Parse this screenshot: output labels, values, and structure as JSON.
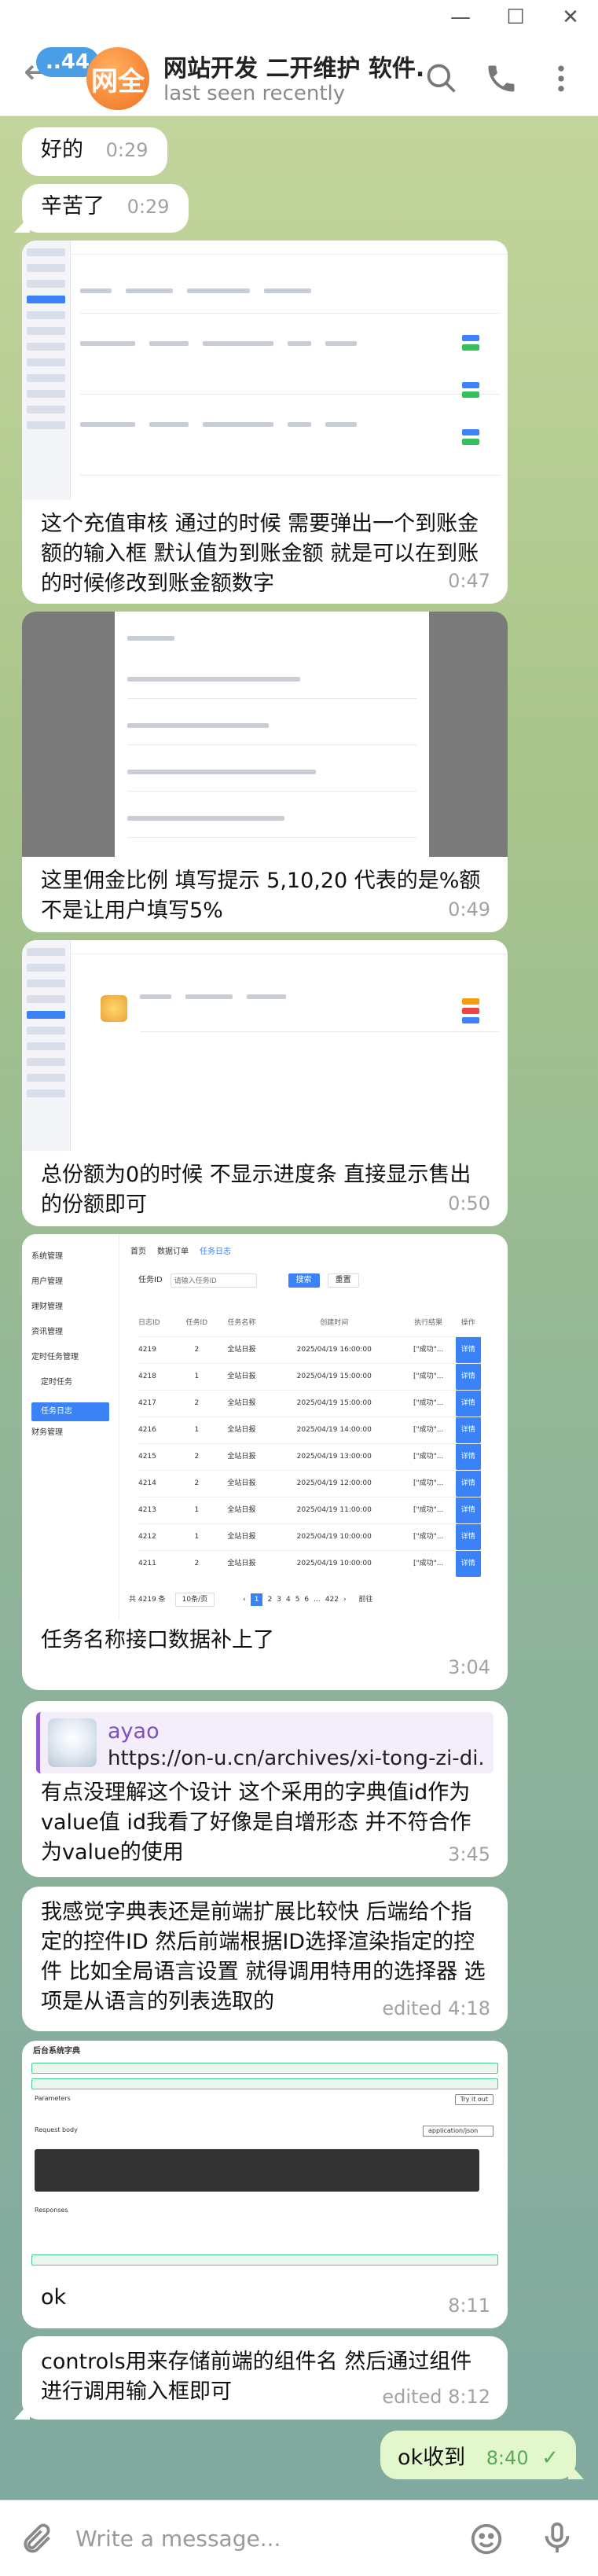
{
  "header": {
    "unread_count": "..44",
    "avatar_text": "网全",
    "title": "网站开发 二开维护 软件...",
    "status": "last seen recently"
  },
  "messages": [
    {
      "text": "好的",
      "time": "0:29"
    },
    {
      "text": "辛苦了",
      "time": "0:29"
    },
    {
      "text": "这个充值审核 通过的时候 需要弹出一个到账金额的输入框 默认值为到账金额 就是可以在到账的时候修改到账金额数字",
      "time": "0:47"
    },
    {
      "text": "这里佣金比例 填写提示 5,10,20 代表的是%额不是让用户填写5%",
      "time": "0:49"
    },
    {
      "text": "总份额为0的时候 不显示进度条 直接显示售出的份额即可",
      "time": "0:50"
    },
    {
      "text": "任务名称接口数据补上了",
      "time": "3:04"
    },
    {
      "link_site": "ayao",
      "link_url": "https://on-u.cn/archives/xi-tong-zi-di...",
      "text": "有点没理解这个设计 这个采用的字典值id作为value值 id我看了好像是自增形态 并不符合作为value的使用",
      "time": "3:45"
    },
    {
      "text": "我感觉字典表还是前端扩展比较快 后端给个指定的控件ID 然后前端根据ID选择渲染指定的控件 比如全局语言设置 就得调用特用的选择器 选项是从语言的列表选取的",
      "time": "edited 4:18"
    },
    {
      "text": "ok",
      "time": "8:11"
    },
    {
      "text": "controls用来存储前端的组件名 然后通过组件进行调用输入框即可",
      "time": "edited 8:12"
    }
  ],
  "outgoing": {
    "text": "ok收到",
    "time": "8:40",
    "check": "✓"
  },
  "screenshot4": {
    "tabs": [
      "首页",
      "数据订单",
      "任务日志"
    ],
    "search_label": "任务ID",
    "search_placeholder": "请输入任务ID",
    "search_button": "搜索",
    "reset_button": "重置",
    "sidebar": [
      "系统管理",
      "用户管理",
      "理财管理",
      "资讯管理",
      "定时任务管理",
      "定时任务",
      "任务日志",
      "财务管理"
    ],
    "columns": [
      "日志ID",
      "任务ID",
      "任务名称",
      "创建时间",
      "执行结果",
      "操作"
    ],
    "rows": [
      [
        "4219",
        "2",
        "全站日报",
        "2025/04/19 16:00:00",
        "[\"成功\"...",
        "详情"
      ],
      [
        "4218",
        "1",
        "全站日报",
        "2025/04/19 15:00:00",
        "[\"成功\"...",
        "详情"
      ],
      [
        "4217",
        "2",
        "全站日报",
        "2025/04/19 15:00:00",
        "[\"成功\"...",
        "详情"
      ],
      [
        "4216",
        "1",
        "全站日报",
        "2025/04/19 14:00:00",
        "[\"成功\"...",
        "详情"
      ],
      [
        "4215",
        "2",
        "全站日报",
        "2025/04/19 13:00:00",
        "[\"成功\"...",
        "详情"
      ],
      [
        "4214",
        "2",
        "全站日报",
        "2025/04/19 12:00:00",
        "[\"成功\"...",
        "详情"
      ],
      [
        "4213",
        "1",
        "全站日报",
        "2025/04/19 11:00:00",
        "[\"成功\"...",
        "详情"
      ],
      [
        "4212",
        "1",
        "全站日报",
        "2025/04/19 10:00:00",
        "[\"成功\"...",
        "详情"
      ],
      [
        "4211",
        "2",
        "全站日报",
        "2025/04/19 10:00:00",
        "[\"成功\"...",
        "详情"
      ]
    ],
    "total": "共 4219 条",
    "page_size": "10条/页",
    "pages": [
      "1",
      "2",
      "3",
      "4",
      "5",
      "6",
      "...",
      "422"
    ],
    "goto": "前往"
  },
  "screenshot5": {
    "title": "后台系统字典",
    "section_parameters": "Parameters",
    "section_request": "Request body",
    "section_responses": "Responses",
    "content_type": "application/json",
    "try_button": "Try it out"
  },
  "composer": {
    "placeholder": "Write a message..."
  }
}
